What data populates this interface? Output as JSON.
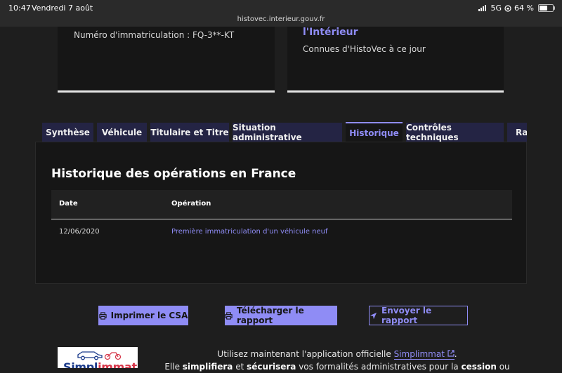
{
  "status_bar": {
    "time": "10:47",
    "date": "Vendredi 7 août",
    "network": "5G",
    "battery": "64 %",
    "url": "histovec.interieur.gouv.fr"
  },
  "cards": {
    "plate": "Numéro d'immatriculation : FQ-3**-KT",
    "org_title": "l'Intérieur",
    "known": "Connues d'HistoVec à ce jour"
  },
  "tabs": [
    {
      "label": "Synthèse",
      "active": false
    },
    {
      "label": "Véhicule",
      "active": false
    },
    {
      "label": "Titulaire et Titre",
      "active": false
    },
    {
      "label": "Situation administrative",
      "active": false
    },
    {
      "label": "Historique",
      "active": true
    },
    {
      "label": "Contrôles techniques",
      "active": false
    },
    {
      "label": "Ra",
      "active": false
    }
  ],
  "history": {
    "title": "Historique des opérations en France",
    "columns": [
      "Date",
      "Opération"
    ],
    "rows": [
      {
        "date": "12/06/2020",
        "operation": "Première immatriculation d'un véhicule neuf"
      }
    ]
  },
  "actions": {
    "print": "Imprimer le CSA",
    "download": "Télécharger le rapport",
    "send": "Envoyer le rapport"
  },
  "promo": {
    "line1_prefix": "Utilisez maintenant l'application officielle ",
    "app_name": "Simplimmat",
    "line1_suffix": ".",
    "line2_a": "Elle ",
    "line2_b": "simplifiera",
    "line2_c": " et ",
    "line2_d": "sécurisera",
    "line2_e": " vos formalités administratives pour la ",
    "line2_f": "cession",
    "line2_g": " ou",
    "logo_text_a": "Simpl",
    "logo_text_b": "immat"
  },
  "colors": {
    "accent": "#8f8cf5",
    "background": "#1e1e1e",
    "panel": "#161616",
    "tab": "#242444"
  }
}
